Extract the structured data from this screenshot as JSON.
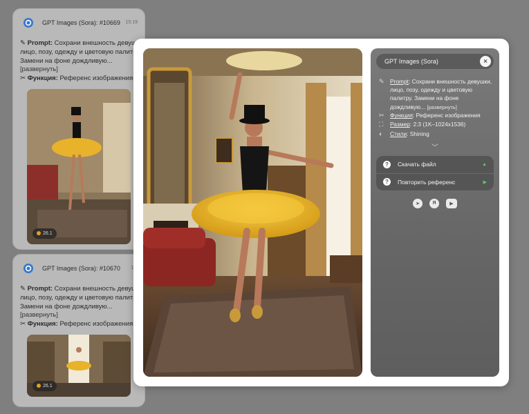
{
  "feed": [
    {
      "app_name": "GPT Images (Sora):",
      "number": "#10669",
      "time": "15:19",
      "prompt_label": "Prompt:",
      "prompt_line1": "Сохрани внешность девушки,",
      "prompt_line2": "лицо, позу, одежду и цветовую палитру.",
      "prompt_line3": "Замени на фоне дождливую...",
      "expand": "[развернуть]",
      "function_label": "Функция:",
      "function_value": "Референс изображения",
      "badge": "26.1"
    },
    {
      "app_name": "GPT Images (Sora):",
      "number": "#10670",
      "time": "15:",
      "prompt_label": "Prompt:",
      "prompt_line1": "Сохрани внешность девушки,",
      "prompt_line2": "лицо, позу, одежду и цветовую палитру.",
      "prompt_line3": "Замени на фоне дождливую...",
      "expand": "[развернуть]",
      "function_label": "Функция:",
      "function_value": "Референс изображения",
      "badge": "26.1"
    }
  ],
  "panel": {
    "title": "GPT Images (Sora)",
    "close": "×",
    "prompt_label": "Prompt",
    "prompt_text": ": Сохрани внешность девушки, лицо, позу, одежду и цветовую палитру. Замени на фоне дождливую...",
    "expand": "[развернуть]",
    "function_label": "Функция",
    "function_value": ": Референс изображения",
    "size_label": "Размер",
    "size_value": ": 2:3 (1K–1024x1536)",
    "style_label": "Стили",
    "style_value": ": Shining",
    "chevron": "﹀",
    "actions": [
      {
        "label": "Скачать файл",
        "arrow": "▲"
      },
      {
        "label": "Повторить референс",
        "arrow": "▶"
      }
    ]
  },
  "colors": {
    "accent_green": "#5bd15b",
    "logo_blue": "#3a78c8"
  }
}
